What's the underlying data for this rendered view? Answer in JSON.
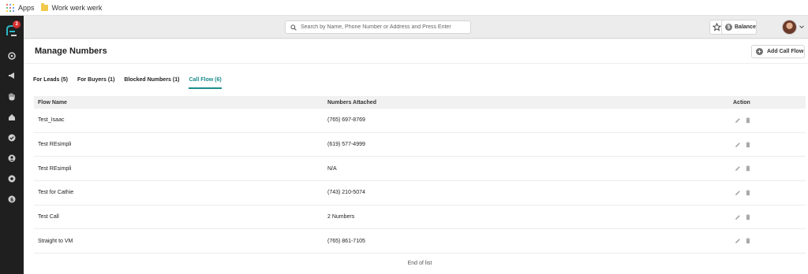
{
  "bookmarks": {
    "apps_label": "Apps",
    "folder_label": "Work werk werk"
  },
  "sidebar": {
    "badge_count": "3"
  },
  "topbar": {
    "search_placeholder": "Search by Name, Phone Number or Address and Press Enter",
    "balance_label": "Balance"
  },
  "page": {
    "title": "Manage Numbers",
    "add_button": "Add Call Flow"
  },
  "tabs": [
    {
      "label": "For Leads (5)"
    },
    {
      "label": "For Buyers (1)"
    },
    {
      "label": "Blocked Numbers (1)"
    },
    {
      "label": "Call Flow (6)"
    }
  ],
  "table": {
    "headers": {
      "name": "Flow Name",
      "numbers": "Numbers Attached",
      "action": "Action"
    },
    "rows": [
      {
        "name": "Test_Isaac",
        "numbers": "(765) 697-8769"
      },
      {
        "name": "Test REsimpli",
        "numbers": "(619) 577-4999"
      },
      {
        "name": "Test REsimpli",
        "numbers": "N/A"
      },
      {
        "name": "Test for Cathie",
        "numbers": "(743) 210-5074"
      },
      {
        "name": "Test Call",
        "numbers": "2 Numbers"
      },
      {
        "name": "Straight to VM",
        "numbers": "(765) 861-7105"
      }
    ],
    "footer": "End of list"
  },
  "colors": {
    "accent": "#1c8c8c",
    "sidebar": "#1f1f1f",
    "badge": "#d32f2f"
  }
}
